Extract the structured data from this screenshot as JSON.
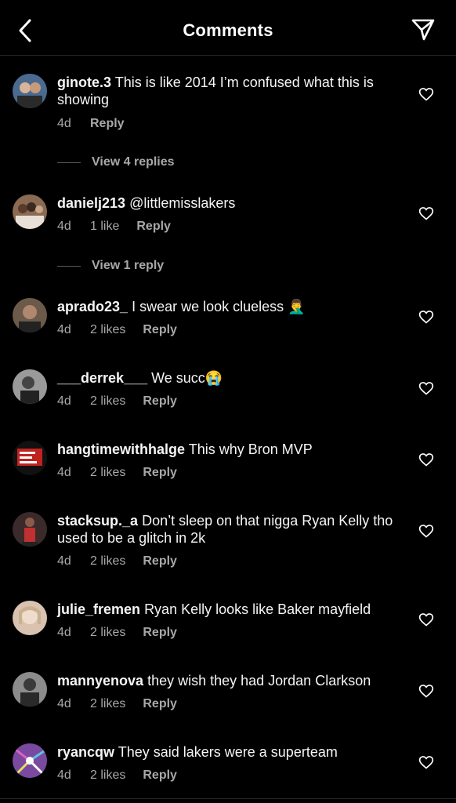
{
  "header": {
    "title": "Comments"
  },
  "comments": [
    {
      "user": "ginote.3",
      "text": "This is like 2014 I’m confused what this is showing",
      "time": "4d",
      "likes": "",
      "reply": "Reply",
      "view_replies": "View 4 replies",
      "avatar_color": "#4a6b8f"
    },
    {
      "user": "danielj213",
      "text": "@littlemisslakers",
      "time": "4d",
      "likes": "1 like",
      "reply": "Reply",
      "view_replies": "View 1 reply",
      "avatar_color": "#8a6a52"
    },
    {
      "user": "aprado23_",
      "text": "I swear we look clueless 🤦‍♂️",
      "time": "4d",
      "likes": "2 likes",
      "reply": "Reply",
      "view_replies": "",
      "avatar_color": "#6b5a4a"
    },
    {
      "user": "___derrek___",
      "text": "We succ😭",
      "time": "4d",
      "likes": "2 likes",
      "reply": "Reply",
      "view_replies": "",
      "avatar_color": "#9a9a9a"
    },
    {
      "user": "hangtimewithhalge",
      "text": "This why Bron MVP",
      "time": "4d",
      "likes": "2 likes",
      "reply": "Reply",
      "view_replies": "",
      "avatar_color": "#c0231f"
    },
    {
      "user": "stacksup._a",
      "text": "Don’t sleep on that nigga Ryan Kelly tho used to be a glitch in 2k",
      "time": "4d",
      "likes": "2 likes",
      "reply": "Reply",
      "view_replies": "",
      "avatar_color": "#3a2a2a"
    },
    {
      "user": "julie_fremen",
      "text": "Ryan Kelly looks like Baker mayfield",
      "time": "4d",
      "likes": "2 likes",
      "reply": "Reply",
      "view_replies": "",
      "avatar_color": "#d9c2b0"
    },
    {
      "user": "mannyenova",
      "text": "they wish they had Jordan Clarkson",
      "time": "4d",
      "likes": "2 likes",
      "reply": "Reply",
      "view_replies": "",
      "avatar_color": "#8c8c8c"
    },
    {
      "user": "ryancqw",
      "text": "They said lakers were a superteam",
      "time": "4d",
      "likes": "2 likes",
      "reply": "Reply",
      "view_replies": "",
      "avatar_color": "#7a4aa0"
    }
  ],
  "colors": {
    "background": "#000000",
    "text": "#f5f5f5",
    "secondary": "#a8a8a8"
  }
}
